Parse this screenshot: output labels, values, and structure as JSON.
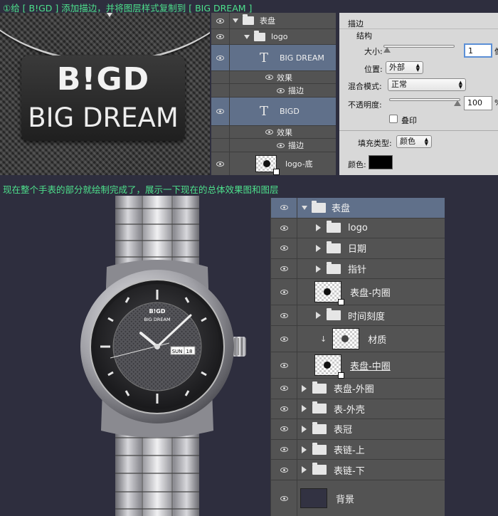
{
  "captions": {
    "step1": "①给 [ B!GD ] 添加描边，并将图层样式复制到 [ BIG DREAM ]",
    "step2": "现在整个手表的部分就绘制完成了，展示一下现在的总体效果图和图层"
  },
  "preview": {
    "logo_top": "B!GD",
    "logo_bottom": "BIG DREAM"
  },
  "layers_top": [
    {
      "label": "表盘",
      "kind": "folder-open",
      "indent": 1
    },
    {
      "label": "logo",
      "kind": "folder-open",
      "indent": 2
    },
    {
      "label": "BIG DREAM",
      "kind": "text",
      "selected": true
    },
    {
      "label": "效果",
      "kind": "effects"
    },
    {
      "label": "描边",
      "kind": "effect-item"
    },
    {
      "label": "BIGD",
      "kind": "text",
      "selected": true
    },
    {
      "label": "效果",
      "kind": "effects"
    },
    {
      "label": "描边",
      "kind": "effect-item"
    },
    {
      "label": "logo-底",
      "kind": "pixel"
    }
  ],
  "stroke_panel": {
    "title": "描边",
    "section": "结构",
    "size_label": "大小:",
    "size_value": "1",
    "size_unit": "像",
    "position_label": "位置:",
    "position_value": "外部",
    "blend_label": "混合模式:",
    "blend_value": "正常",
    "opacity_label": "不透明度:",
    "opacity_value": "100",
    "opacity_unit": "%",
    "overprint_label": "叠印",
    "fill_type_label": "填充类型:",
    "fill_type_value": "颜色",
    "color_label": "颜色:",
    "color_value": "#000000"
  },
  "watch": {
    "brand_top": "B!GD",
    "brand_bottom": "BIG DREAM",
    "date_day": "SUN",
    "date_num": "18"
  },
  "layers_bottom": [
    {
      "label": "表盘",
      "kind": "folder-open",
      "selected": true
    },
    {
      "label": "logo",
      "kind": "folder-closed",
      "indent": 2
    },
    {
      "label": "日期",
      "kind": "folder-closed",
      "indent": 2
    },
    {
      "label": "指针",
      "kind": "folder-closed",
      "indent": 2
    },
    {
      "label": "表盘-内圈",
      "kind": "pixel",
      "indent": 2
    },
    {
      "label": "时间刻度",
      "kind": "folder-closed",
      "indent": 2
    },
    {
      "label": "材质",
      "kind": "pixel-clipped",
      "indent": 3
    },
    {
      "label": "表盘-中圈",
      "kind": "pixel",
      "indent": 2,
      "underline": true
    },
    {
      "label": "表盘-外圈",
      "kind": "folder-closed",
      "indent": 1
    },
    {
      "label": "表-外壳",
      "kind": "folder-closed",
      "indent": 1
    },
    {
      "label": "表冠",
      "kind": "folder-closed",
      "indent": 1
    },
    {
      "label": "表链-上",
      "kind": "folder-closed",
      "indent": 1
    },
    {
      "label": "表链-下",
      "kind": "folder-closed",
      "indent": 1
    },
    {
      "label": "背景",
      "kind": "background"
    }
  ]
}
